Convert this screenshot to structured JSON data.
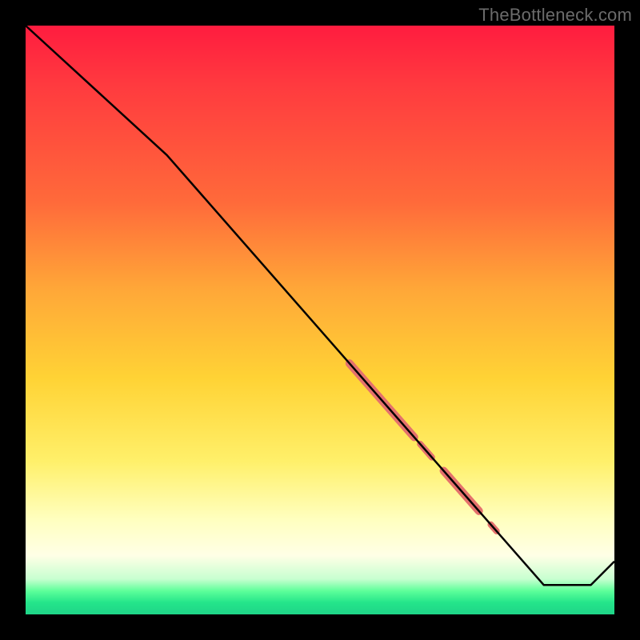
{
  "watermark": "TheBottleneck.com",
  "chart_data": {
    "type": "line",
    "title": "",
    "xlabel": "",
    "ylabel": "",
    "xlim": [
      0,
      100
    ],
    "ylim": [
      0,
      100
    ],
    "grid": false,
    "legend": false,
    "background_gradient": {
      "orientation": "vertical",
      "stops": [
        {
          "pos": 0.0,
          "color": "#ff1c3f"
        },
        {
          "pos": 0.5,
          "color": "#ffc838"
        },
        {
          "pos": 0.8,
          "color": "#ffff9a"
        },
        {
          "pos": 0.95,
          "color": "#7dffac"
        },
        {
          "pos": 1.0,
          "color": "#1fd488"
        }
      ]
    },
    "series": [
      {
        "name": "bottleneck-curve",
        "color": "#000000",
        "points": [
          {
            "x": 0,
            "y": 100
          },
          {
            "x": 24,
            "y": 78
          },
          {
            "x": 88,
            "y": 5
          },
          {
            "x": 96,
            "y": 5
          },
          {
            "x": 100,
            "y": 9
          }
        ]
      }
    ],
    "highlight_segments": [
      {
        "name": "data-cluster",
        "color": "#e4716c",
        "along_series": "bottleneck-curve",
        "segments": [
          {
            "x_start": 55,
            "x_end": 66,
            "width": 10
          },
          {
            "x_start": 67,
            "x_end": 69,
            "width": 8
          },
          {
            "x_start": 71,
            "x_end": 77,
            "width": 10
          },
          {
            "x_start": 79,
            "x_end": 80,
            "width": 8
          }
        ]
      }
    ]
  }
}
